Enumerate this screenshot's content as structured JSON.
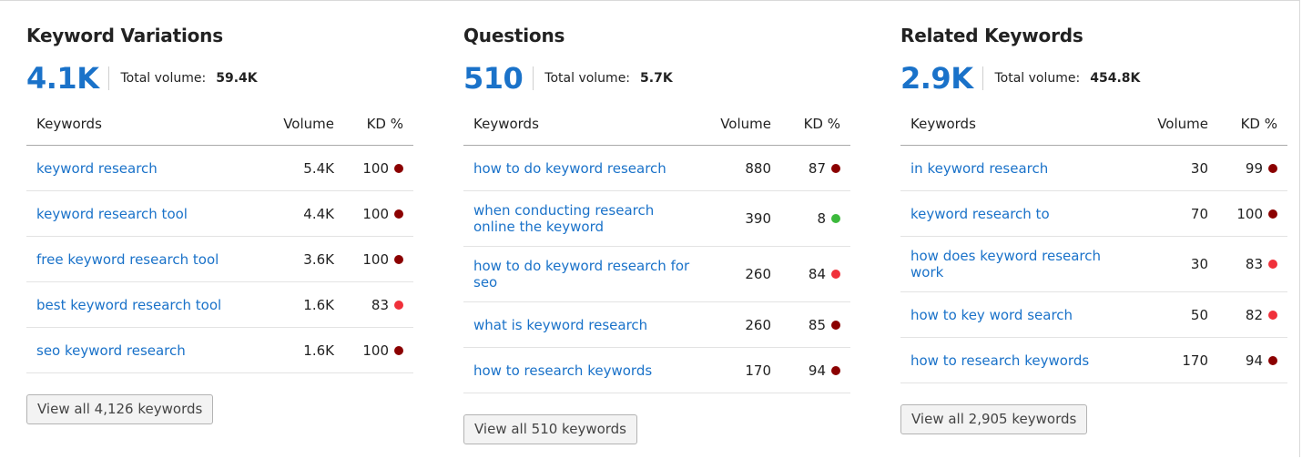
{
  "colors": {
    "link": "#1a72c9",
    "kd_dark_red": "#8b0000",
    "kd_red": "#f0303a",
    "kd_green": "#3cb93c"
  },
  "columns": {
    "keywords": "Keywords",
    "volume": "Volume",
    "kd": "KD %"
  },
  "panels": [
    {
      "title": "Keyword Variations",
      "count": "4.1K",
      "total_label": "Total volume:",
      "total_value": "59.4K",
      "rows": [
        {
          "keyword": "keyword research",
          "volume": "5.4K",
          "kd": "100",
          "kd_color": "#8b0000"
        },
        {
          "keyword": "keyword research tool",
          "volume": "4.4K",
          "kd": "100",
          "kd_color": "#8b0000"
        },
        {
          "keyword": "free keyword research tool",
          "volume": "3.6K",
          "kd": "100",
          "kd_color": "#8b0000"
        },
        {
          "keyword": "best keyword research tool",
          "volume": "1.6K",
          "kd": "83",
          "kd_color": "#f0303a"
        },
        {
          "keyword": "seo keyword research",
          "volume": "1.6K",
          "kd": "100",
          "kd_color": "#8b0000"
        }
      ],
      "button": "View all 4,126 keywords"
    },
    {
      "title": "Questions",
      "count": "510",
      "total_label": "Total volume:",
      "total_value": "5.7K",
      "rows": [
        {
          "keyword": "how to do keyword research",
          "volume": "880",
          "kd": "87",
          "kd_color": "#8b0000"
        },
        {
          "keyword": "when conducting research online the keyword",
          "volume": "390",
          "kd": "8",
          "kd_color": "#3cb93c"
        },
        {
          "keyword": "how to do keyword research for seo",
          "volume": "260",
          "kd": "84",
          "kd_color": "#f0303a"
        },
        {
          "keyword": "what is keyword research",
          "volume": "260",
          "kd": "85",
          "kd_color": "#8b0000"
        },
        {
          "keyword": "how to research keywords",
          "volume": "170",
          "kd": "94",
          "kd_color": "#8b0000"
        }
      ],
      "button": "View all 510 keywords"
    },
    {
      "title": "Related Keywords",
      "count": "2.9K",
      "total_label": "Total volume:",
      "total_value": "454.8K",
      "rows": [
        {
          "keyword": "in keyword research",
          "volume": "30",
          "kd": "99",
          "kd_color": "#8b0000"
        },
        {
          "keyword": "keyword research to",
          "volume": "70",
          "kd": "100",
          "kd_color": "#8b0000"
        },
        {
          "keyword": "how does keyword research work",
          "volume": "30",
          "kd": "83",
          "kd_color": "#f0303a"
        },
        {
          "keyword": "how to key word search",
          "volume": "50",
          "kd": "82",
          "kd_color": "#f0303a"
        },
        {
          "keyword": "how to research keywords",
          "volume": "170",
          "kd": "94",
          "kd_color": "#8b0000"
        }
      ],
      "button": "View all 2,905 keywords"
    }
  ]
}
